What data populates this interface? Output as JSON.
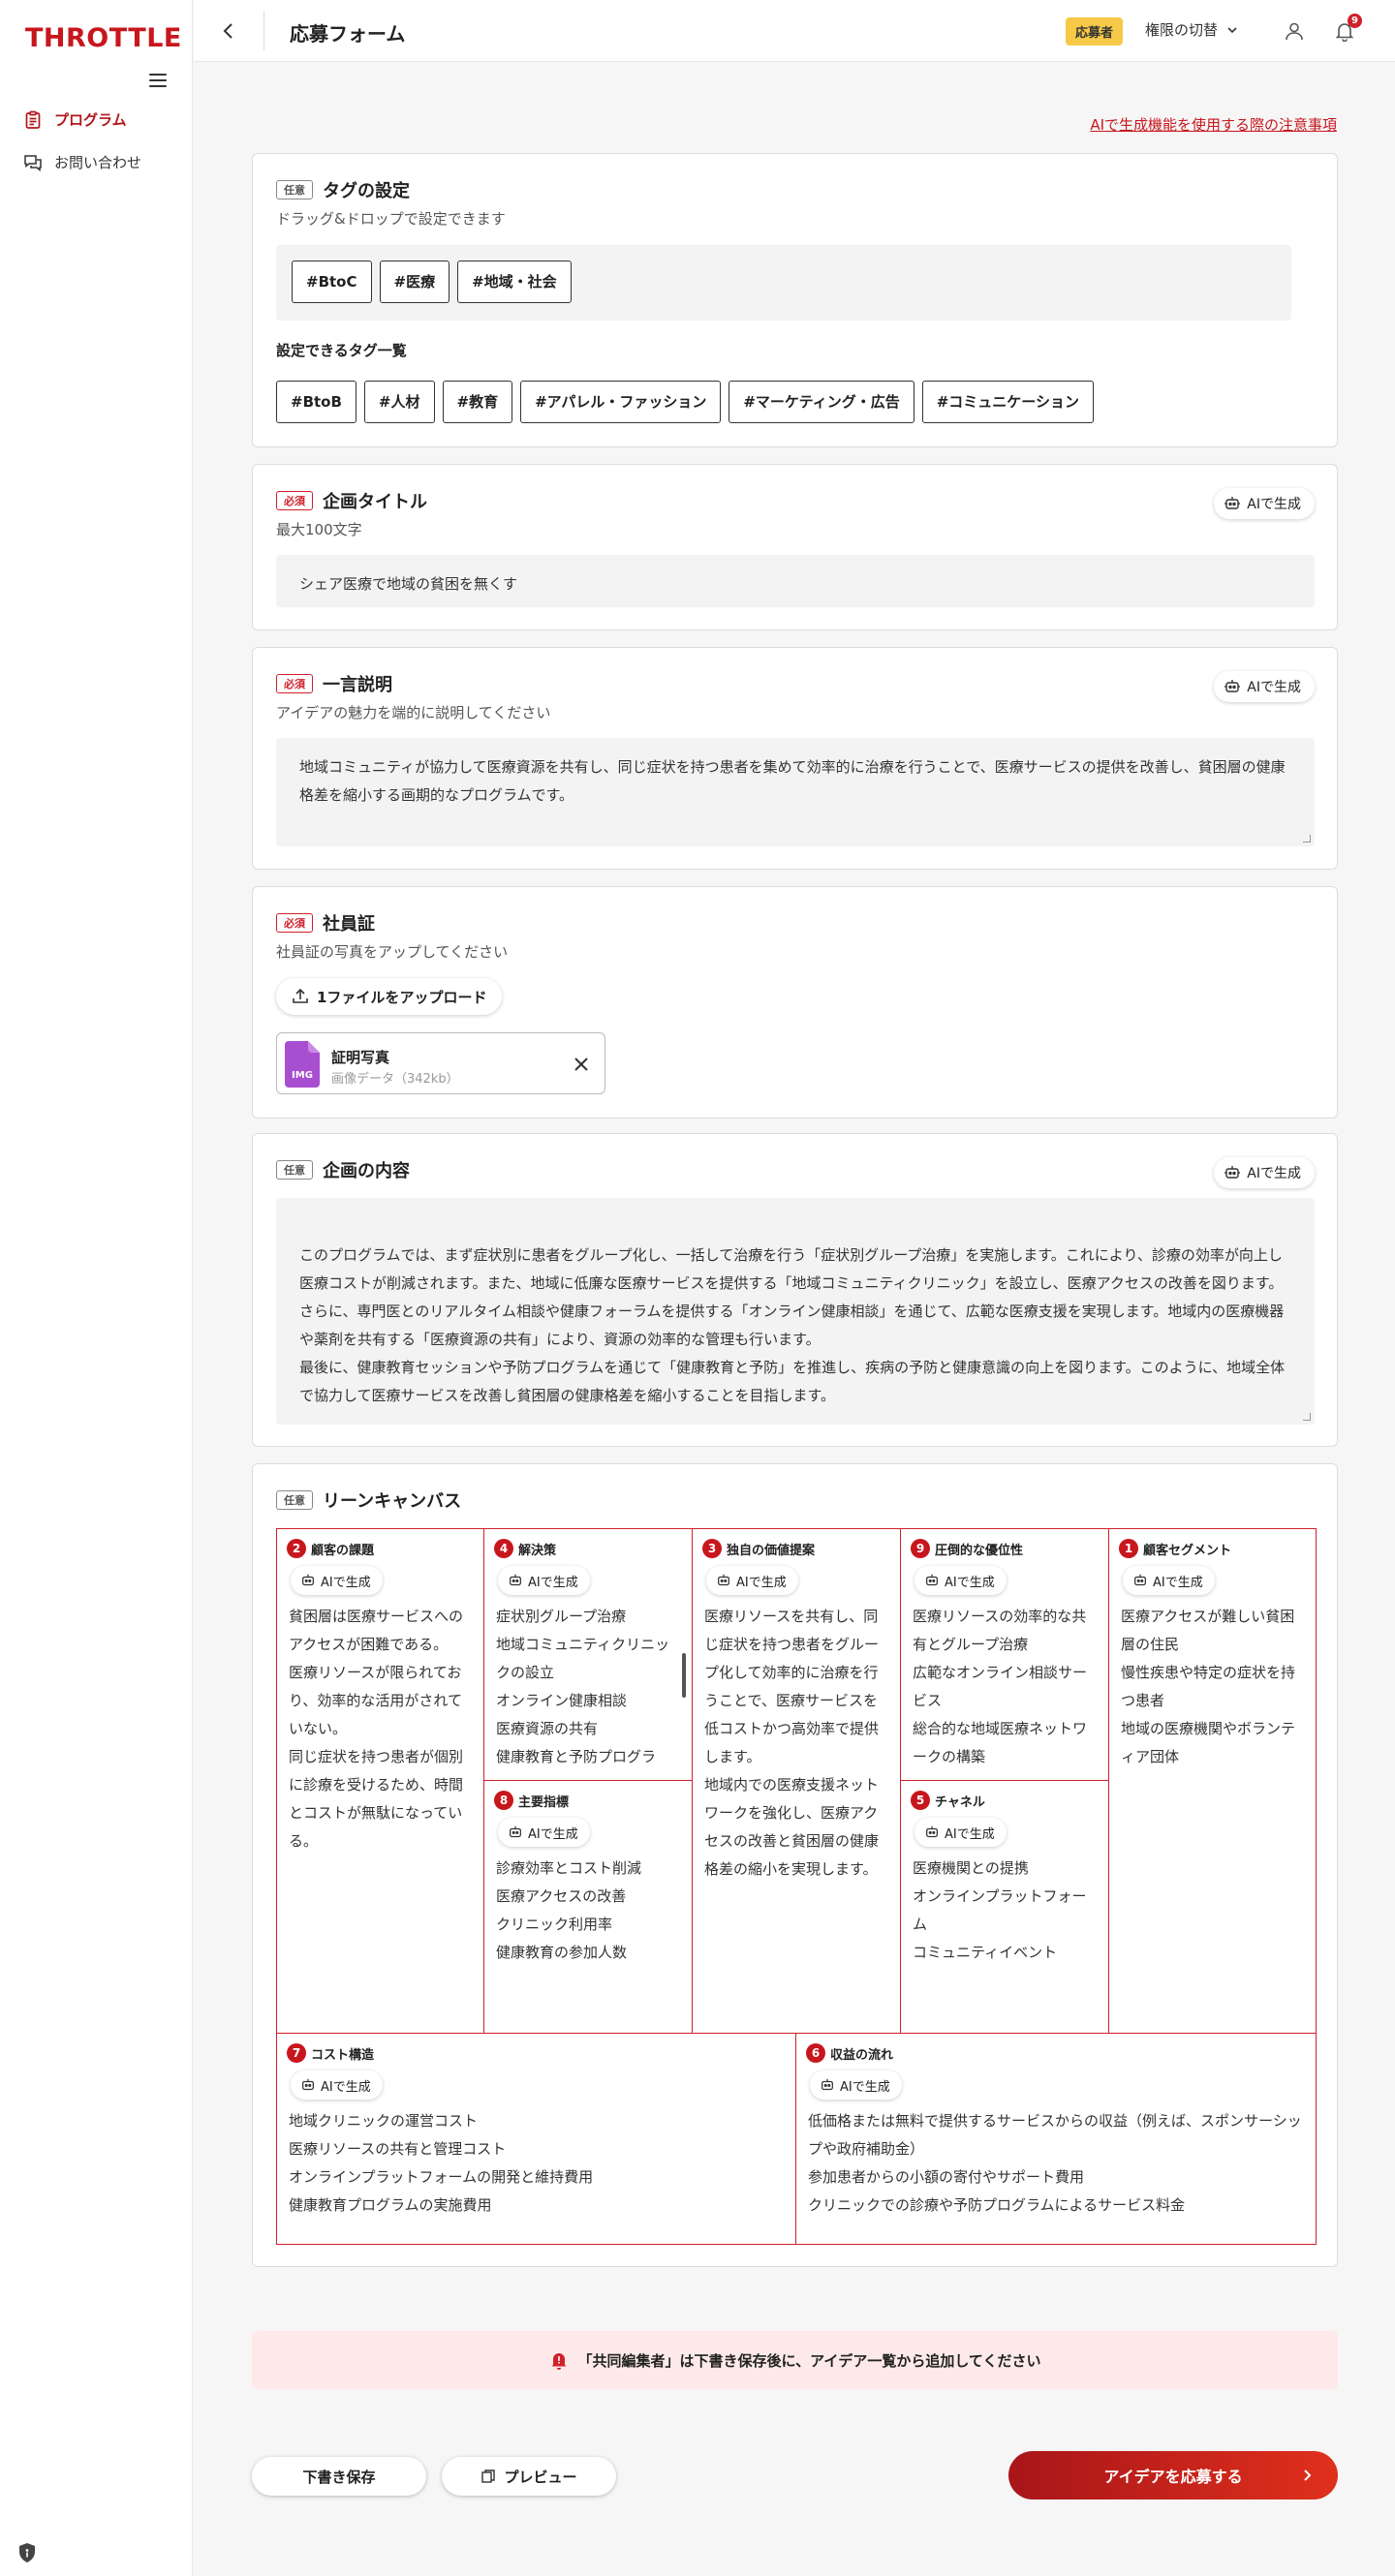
{
  "brand": {
    "logo": "THROTTLE",
    "accent": "#c8161d"
  },
  "sidebar": {
    "items": [
      {
        "label": "プログラム",
        "icon": "clipboard-icon",
        "active": true
      },
      {
        "label": "お問い合わせ",
        "icon": "chat-icon",
        "active": false
      }
    ]
  },
  "header": {
    "title": "応募フォーム",
    "role_badge": "応募者",
    "role_switch": "権限の切替",
    "notification_count": "9"
  },
  "ai_notice": "AIで生成機能を使用する際の注意事項",
  "ai_button_label": "AIで生成",
  "badges": {
    "optional": "任意",
    "required": "必須"
  },
  "tags": {
    "title": "タグの設定",
    "subtitle": "ドラッグ&ドロップで設定できます",
    "selected": [
      "#BtoC",
      "#医療",
      "#地域・社会"
    ],
    "available_title": "設定できるタグ一覧",
    "available": [
      "#BtoB",
      "#人材",
      "#教育",
      "#アパレル・ファッション",
      "#マーケティング・広告",
      "#コミュニケーション"
    ]
  },
  "project_title": {
    "title": "企画タイトル",
    "subtitle": "最大100文字",
    "value": "シェア医療で地域の貧困を無くす"
  },
  "summary": {
    "title": "一言説明",
    "subtitle": "アイデアの魅力を端的に説明してください",
    "value": "地域コミュニティが協力して医療資源を共有し、同じ症状を持つ患者を集めて効率的に治療を行うことで、医療サービスの提供を改善し、貧困層の健康格差を縮小する画期的なプログラムです。"
  },
  "employee_id": {
    "title": "社員証",
    "subtitle": "社員証の写真をアップしてください",
    "upload_label": "1ファイルをアップロード",
    "file_name": "証明写真",
    "file_meta": "画像データ（342kb）",
    "file_type": "IMG"
  },
  "content": {
    "title": "企画の内容",
    "value": "このプログラムでは、まず症状別に患者をグループ化し、一括して治療を行う「症状別グループ治療」を実施します。これにより、診療の効率が向上し医療コストが削減されます。また、地域に低廉な医療サービスを提供する「地域コミュニティクリニック」を設立し、医療アクセスの改善を図ります。\nさらに、専門医とのリアルタイム相談や健康フォーラムを提供する「オンライン健康相談」を通じて、広範な医療支援を実現します。地域内の医療機器や薬剤を共有する「医療資源の共有」により、資源の効率的な管理も行います。\n最後に、健康教育セッションや予防プログラムを通じて「健康教育と予防」を推進し、疾病の予防と健康意識の向上を図ります。このように、地域全体で協力して医療サービスを改善し貧困層の健康格差を縮小することを目指します。"
  },
  "lean_canvas": {
    "title": "リーンキャンバス",
    "cells": {
      "problem": {
        "num": "2",
        "label": "顧客の課題",
        "body": "貧困層は医療サービスへのアクセスが困難である。\n医療リソースが限られており、効率的な活用がされていない。\n同じ症状を持つ患者が個別に診療を受けるため、時間とコストが無駄になっている。"
      },
      "solution": {
        "num": "4",
        "label": "解決策",
        "body": "症状別グループ治療\n地域コミュニティクリニックの設立\nオンライン健康相談\n医療資源の共有\n健康教育と予防プログラ"
      },
      "uvp": {
        "num": "3",
        "label": "独自の価値提案",
        "body": "医療リソースを共有し、同じ症状を持つ患者をグループ化して効率的に治療を行うことで、医療サービスを低コストかつ高効率で提供します。\n地域内での医療支援ネットワークを強化し、医療アクセスの改善と貧困層の健康格差の縮小を実現します。"
      },
      "advantage": {
        "num": "9",
        "label": "圧倒的な優位性",
        "body": "医療リソースの効率的な共有とグループ治療\n広範なオンライン相談サービス\n総合的な地域医療ネットワークの構築"
      },
      "segments": {
        "num": "1",
        "label": "顧客セグメント",
        "body": "医療アクセスが難しい貧困層の住民\n慢性疾患や特定の症状を持つ患者\n地域の医療機関やボランティア団体"
      },
      "metrics": {
        "num": "8",
        "label": "主要指標",
        "body": "診療効率とコスト削減\n医療アクセスの改善\nクリニック利用率\n健康教育の参加人数"
      },
      "channels": {
        "num": "5",
        "label": "チャネル",
        "body": "医療機関との提携\nオンラインプラットフォーム\nコミュニティイベント"
      },
      "cost": {
        "num": "7",
        "label": "コスト構造",
        "body": "地域クリニックの運営コスト\n医療リソースの共有と管理コスト\nオンラインプラットフォームの開発と維持費用\n健康教育プログラムの実施費用"
      },
      "revenue": {
        "num": "6",
        "label": "収益の流れ",
        "body": "低価格または無料で提供するサービスからの収益（例えば、スポンサーシップや政府補助金）\n参加患者からの小額の寄付やサポート費用\nクリニックでの診療や予防プログラムによるサービス料金"
      }
    }
  },
  "co_editor_notice": "「共同編集者」は下書き保存後に、アイデア一覧から追加してください",
  "actions": {
    "draft": "下書き保存",
    "preview": "プレビュー",
    "submit": "アイデアを応募する"
  }
}
